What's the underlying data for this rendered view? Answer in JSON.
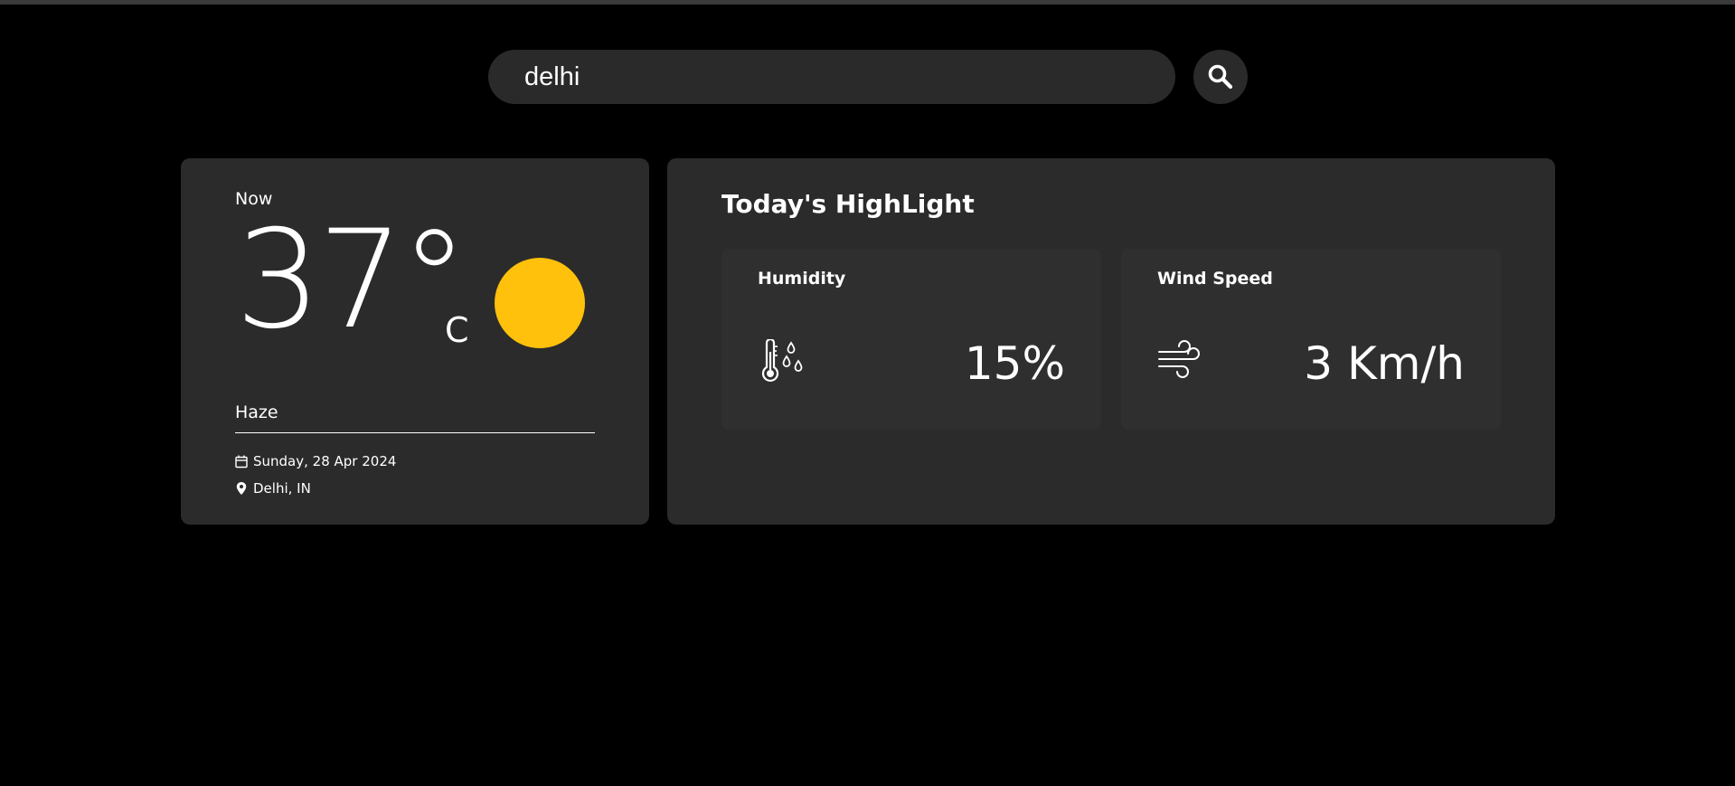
{
  "search": {
    "value": "delhi",
    "button_icon": "search-icon"
  },
  "current": {
    "label": "Now",
    "temperature": "37°",
    "unit": "C",
    "icon": "sun-icon",
    "icon_color": "#ffc10b",
    "condition": "Haze",
    "date": "Sunday, 28 Apr 2024",
    "date_icon": "calendar-icon",
    "location": "Delhi, IN",
    "location_icon": "location-pin-icon"
  },
  "highlights": {
    "title": "Today's HighLight",
    "humidity": {
      "label": "Humidity",
      "value": "15%",
      "icon": "thermometer-droplets-icon"
    },
    "wind": {
      "label": "Wind Speed",
      "value": "3 Km/h",
      "icon": "wind-icon"
    }
  },
  "colors": {
    "background": "#000000",
    "card": "#2b2b2b",
    "accent": "#ffc10b"
  }
}
